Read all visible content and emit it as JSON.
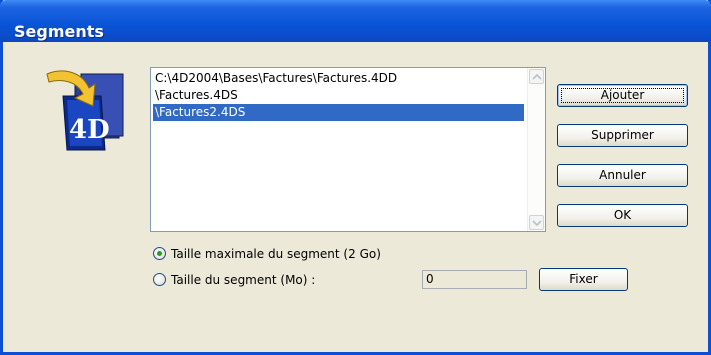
{
  "window": {
    "title": "Segments"
  },
  "segments_list": {
    "items": [
      {
        "label": "C:\\4D2004\\Bases\\Factures\\Factures.4DD",
        "selected": false
      },
      {
        "label": "\\Factures.4DS",
        "selected": false
      },
      {
        "label": "\\Factures2.4DS",
        "selected": true
      }
    ]
  },
  "buttons": {
    "add": "Ajouter",
    "remove": "Supprimer",
    "cancel": "Annuler",
    "ok": "OK",
    "set": "Fixer"
  },
  "options": {
    "max_size_label": "Taille maximale du segment (2 Go)",
    "max_size_selected": true,
    "segment_size_label": "Taille du segment (Mo) :",
    "segment_size_selected": false,
    "segment_size_value": "0"
  },
  "icons": {
    "logo": "4d-logo-icon",
    "scroll_up": "scroll-up-arrow-icon",
    "scroll_down": "scroll-down-arrow-icon"
  },
  "colors": {
    "titlebar": "#0a55d8",
    "dialog_bg": "#ece9d8",
    "selection": "#316ac5",
    "radio_dot": "#21a121"
  }
}
